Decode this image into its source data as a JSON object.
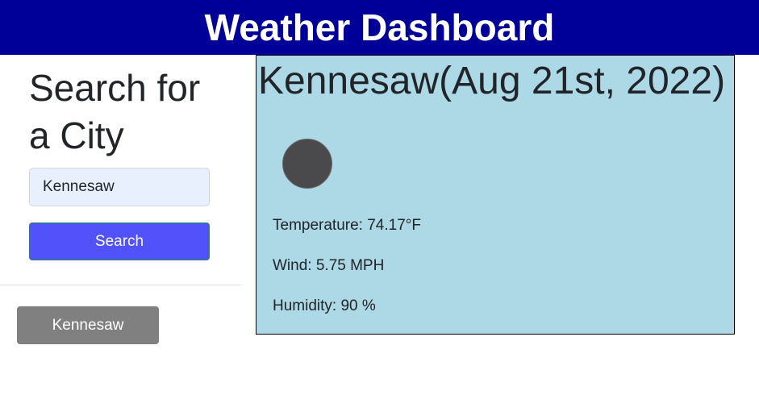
{
  "header": {
    "title": "Weather Dashboard"
  },
  "sidebar": {
    "heading": "Search for a City",
    "search_input": {
      "value": "Kennesaw",
      "placeholder": ""
    },
    "search_button_label": "Search",
    "history": [
      {
        "label": "Kennesaw"
      }
    ]
  },
  "current": {
    "title": "Kennesaw(Aug 21st, 2022)",
    "icon": "weather-condition-icon",
    "temperature": "Temperature: 74.17°F",
    "wind": "Wind: 5.75 MPH",
    "humidity": "Humidity: 90 %"
  },
  "colors": {
    "header_bg": "#000099",
    "search_button": "#5252fa",
    "history_button": "#808080",
    "card_bg": "#add8e6",
    "input_bg": "#e8f0fe"
  }
}
